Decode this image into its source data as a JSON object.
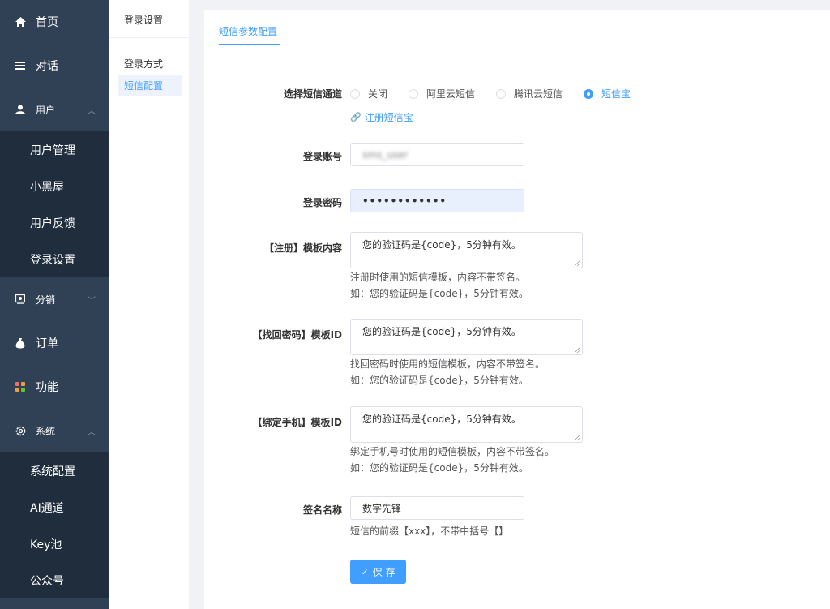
{
  "sidebar": {
    "home": "首页",
    "chat": "对话",
    "user": {
      "label": "用户",
      "items": [
        "用户管理",
        "小黑屋",
        "用户反馈",
        "登录设置"
      ]
    },
    "distribution": "分销",
    "order": "订单",
    "features": "功能",
    "system": {
      "label": "系统",
      "items": [
        "系统配置",
        "AI通道",
        "Key池",
        "公众号"
      ]
    }
  },
  "submenu": {
    "title": "登录设置",
    "items": [
      "登录方式",
      "短信配置"
    ]
  },
  "tab": "短信参数配置",
  "form": {
    "channel_label": "选择短信通道",
    "channels": [
      "关闭",
      "阿里云短信",
      "腾讯云短信",
      "短信宝"
    ],
    "selected_channel": "短信宝",
    "register_link": "注册短信宝",
    "account_label": "登录账号",
    "account_value": "sms_user",
    "password_label": "登录密码",
    "password_value": "••••••••••••",
    "register_tpl_label": "【注册】模板内容",
    "register_tpl_value": "您的验证码是{code}，5分钟有效。",
    "register_help1": "注册时使用的短信模板，内容不带签名。",
    "register_help2": "如：您的验证码是{code}，5分钟有效。",
    "forgot_tpl_label": "【找回密码】模板ID",
    "forgot_tpl_value": "您的验证码是{code}，5分钟有效。",
    "forgot_help1": "找回密码时使用的短信模板，内容不带签名。",
    "forgot_help2": "如：您的验证码是{code}，5分钟有效。",
    "bind_tpl_label": "【绑定手机】模板ID",
    "bind_tpl_value": "您的验证码是{code}，5分钟有效。",
    "bind_help1": "绑定手机号时使用的短信模板，内容不带签名。",
    "bind_help2": "如：您的验证码是{code}，5分钟有效。",
    "sign_label": "签名名称",
    "sign_value": "数字先锋",
    "sign_help": "短信的前缀【xxx】，不带中括号【】",
    "save_label": "保 存"
  },
  "colors": {
    "sidebar": "#304156",
    "submenu": "#1f2d3d",
    "accent": "#409eff"
  }
}
